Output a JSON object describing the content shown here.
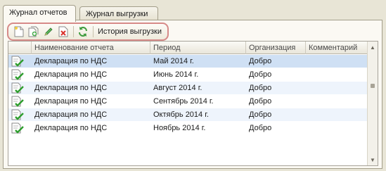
{
  "tabs": [
    {
      "label": "Журнал отчетов",
      "active": true
    },
    {
      "label": "Журнал выгрузки",
      "active": false
    }
  ],
  "toolbar": {
    "buttons": [
      {
        "icon": "new-document-icon"
      },
      {
        "icon": "copy-document-icon"
      },
      {
        "icon": "edit-pencil-icon"
      },
      {
        "icon": "delete-icon"
      },
      {
        "icon": "refresh-icon"
      }
    ],
    "history_label": "История выгрузки",
    "highlight_color": "#d68a88"
  },
  "table": {
    "columns": [
      "",
      "Наименование отчета",
      "Период",
      "Организация",
      "Комментарий"
    ],
    "rows": [
      {
        "name": "Декларация по НДС",
        "period": "Май 2014 г.",
        "org": "Добро",
        "comment": "",
        "selected": true
      },
      {
        "name": "Декларация по НДС",
        "period": "Июнь 2014 г.",
        "org": "Добро",
        "comment": ""
      },
      {
        "name": "Декларация по НДС",
        "period": "Август 2014 г.",
        "org": "Добро",
        "comment": ""
      },
      {
        "name": "Декларация по НДС",
        "period": "Сентябрь 2014 г.",
        "org": "Добро",
        "comment": ""
      },
      {
        "name": "Декларация по НДС",
        "period": "Октябрь 2014 г.",
        "org": "Добро",
        "comment": ""
      },
      {
        "name": "Декларация по НДС",
        "period": "Ноябрь 2014 г.",
        "org": "Добро",
        "comment": ""
      }
    ],
    "row_icon": "document-checkmark-icon"
  }
}
